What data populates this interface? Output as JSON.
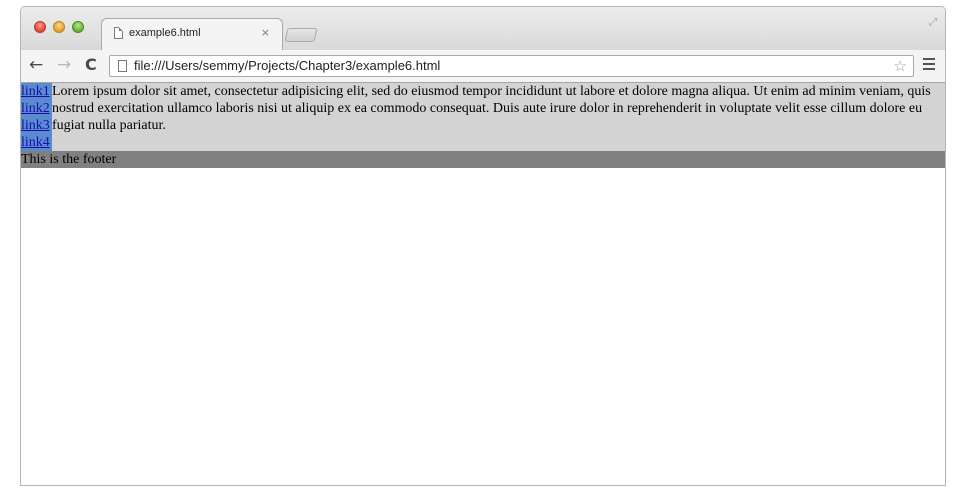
{
  "tab": {
    "title": "example6.html",
    "close_glyph": "×"
  },
  "toolbar": {
    "back_glyph": "←",
    "forward_glyph": "→",
    "reload_glyph": "C",
    "url": "file:///Users/semmy/Projects/Chapter3/example6.html",
    "star_glyph": "☆"
  },
  "page": {
    "nav_links": [
      "link1",
      "link2",
      "link3",
      "link4"
    ],
    "main_text": "Lorem ipsum dolor sit amet, consectetur adipisicing elit, sed do eiusmod tempor incididunt ut labore et dolore magna aliqua. Ut enim ad minim veniam, quis nostrud exercitation ullamco laboris nisi ut aliquip ex ea commodo consequat. Duis aute irure dolor in reprehenderit in voluptate velit esse cillum dolore eu fugiat nulla pariatur.",
    "footer_text": "This is the footer"
  },
  "icons": {
    "traffic_lights": [
      "close-button",
      "minimize-button",
      "zoom-button"
    ],
    "tab_icon": "page-icon",
    "omnibox_icon": "page-icon",
    "bookmark": "star-icon",
    "menu": "hamburger-menu-icon",
    "fullscreen": "resize-arrows-icon"
  },
  "colors": {
    "content_bg": "#d3d3d3",
    "nav_bg": "#5b8bcf",
    "footer_bg": "#808080",
    "link": "#1a0dab"
  }
}
